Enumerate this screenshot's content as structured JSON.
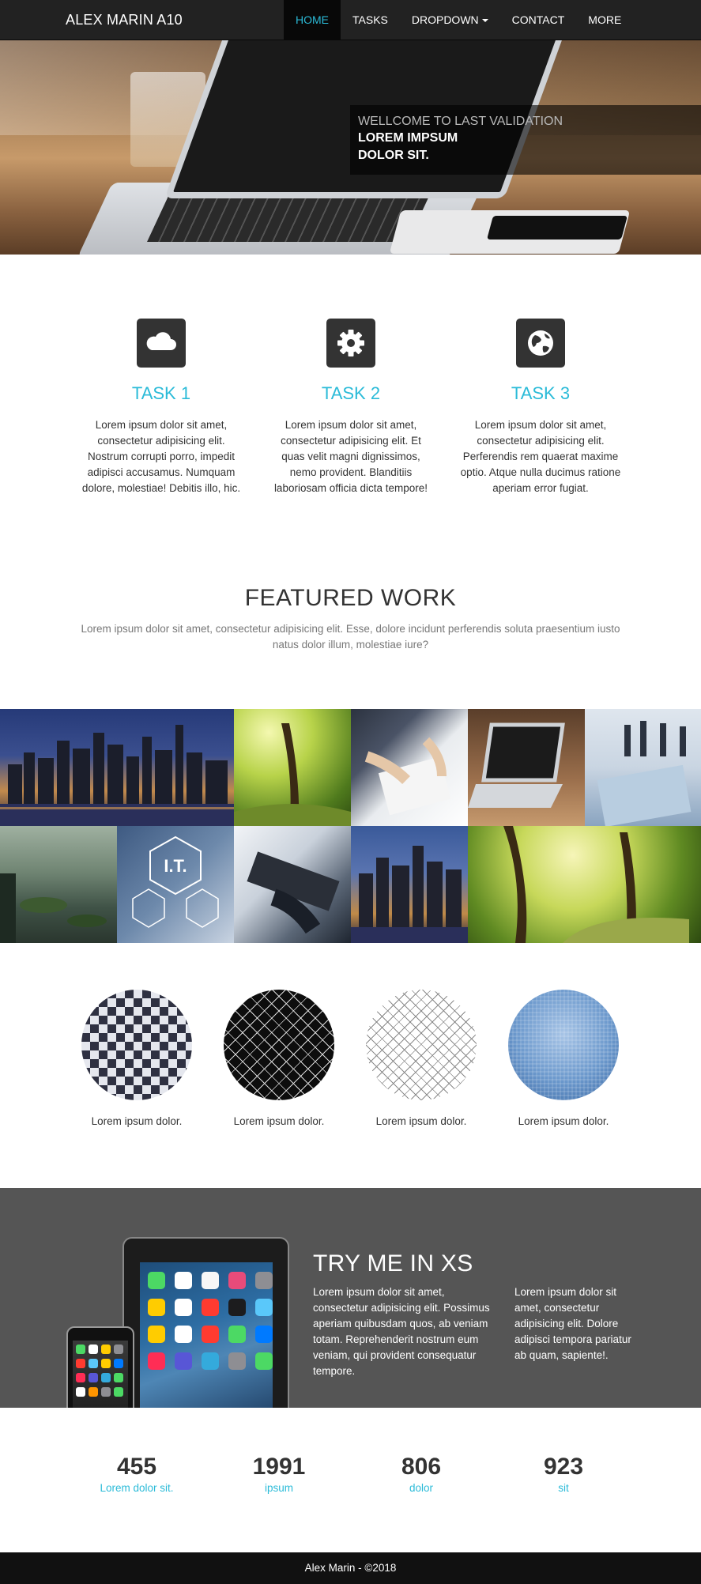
{
  "navbar": {
    "brand": "ALEX MARIN A10",
    "items": [
      {
        "label": "HOME"
      },
      {
        "label": "TASKS"
      },
      {
        "label": "DROPDOWN"
      },
      {
        "label": "CONTACT"
      },
      {
        "label": "MORE"
      }
    ],
    "active_color": "#2bbbd8"
  },
  "hero": {
    "caption_top": "WELLCOME TO LAST VALIDATION",
    "caption_line1": "LOREM IMPSUM",
    "caption_line2": "DOLOR SIT."
  },
  "tasks": [
    {
      "icon": "cloud-icon",
      "title": "TASK 1",
      "text": "Lorem ipsum dolor sit amet, consectetur adipisicing elit. Nostrum corrupti porro, impedit adipisci accusamus. Numquam dolore, molestiae! Debitis illo, hic."
    },
    {
      "icon": "gear-icon",
      "title": "TASK 2",
      "text": "Lorem ipsum dolor sit amet, consectetur adipisicing elit. Et quas velit magni dignissimos, nemo provident. Blanditiis laboriosam officia dicta tempore!"
    },
    {
      "icon": "globe-icon",
      "title": "TASK 3",
      "text": "Lorem ipsum dolor sit amet, consectetur adipisicing elit. Perferendis rem quaerat maxime optio. Atque nulla ducimus ratione aperiam error fugiat."
    }
  ],
  "featured": {
    "title": "FEATURED WORK",
    "subtitle": "Lorem ipsum dolor sit amet, consectetur adipisicing elit. Esse, dolore incidunt perferendis soluta praesentium iusto natus dolor illum, molestiae iure?"
  },
  "gallery": [
    {
      "name": "city-night-image"
    },
    {
      "name": "forest-image"
    },
    {
      "name": "meeting-image"
    },
    {
      "name": "laptop-image"
    },
    {
      "name": "business-people-image"
    },
    {
      "name": "river-image"
    },
    {
      "name": "it-hexagon-image"
    },
    {
      "name": "typing-image"
    },
    {
      "name": "city-night-2-image"
    },
    {
      "name": "forest-road-image"
    }
  ],
  "circles": [
    {
      "label": "Lorem ipsum dolor."
    },
    {
      "label": "Lorem ipsum dolor."
    },
    {
      "label": "Lorem ipsum dolor."
    },
    {
      "label": "Lorem ipsum dolor."
    }
  ],
  "try_section": {
    "title": "TRY ME IN XS",
    "col1": "Lorem ipsum dolor sit amet, consectetur adipisicing elit. Possimus aperiam quibusdam quos, ab veniam totam. Reprehenderit nostrum eum veniam, qui provident consequatur tempore.",
    "col2": "Lorem ipsum dolor sit amet, consectetur adipisicing elit. Dolore adipisci tempora pariatur ab quam, sapiente!."
  },
  "stats": [
    {
      "number": "455",
      "label": "Lorem dolor sit."
    },
    {
      "number": "1991",
      "label": "ipsum"
    },
    {
      "number": "806",
      "label": "dolor"
    },
    {
      "number": "923",
      "label": "sit"
    }
  ],
  "footer": {
    "text": "Alex Marin - ©2018"
  }
}
